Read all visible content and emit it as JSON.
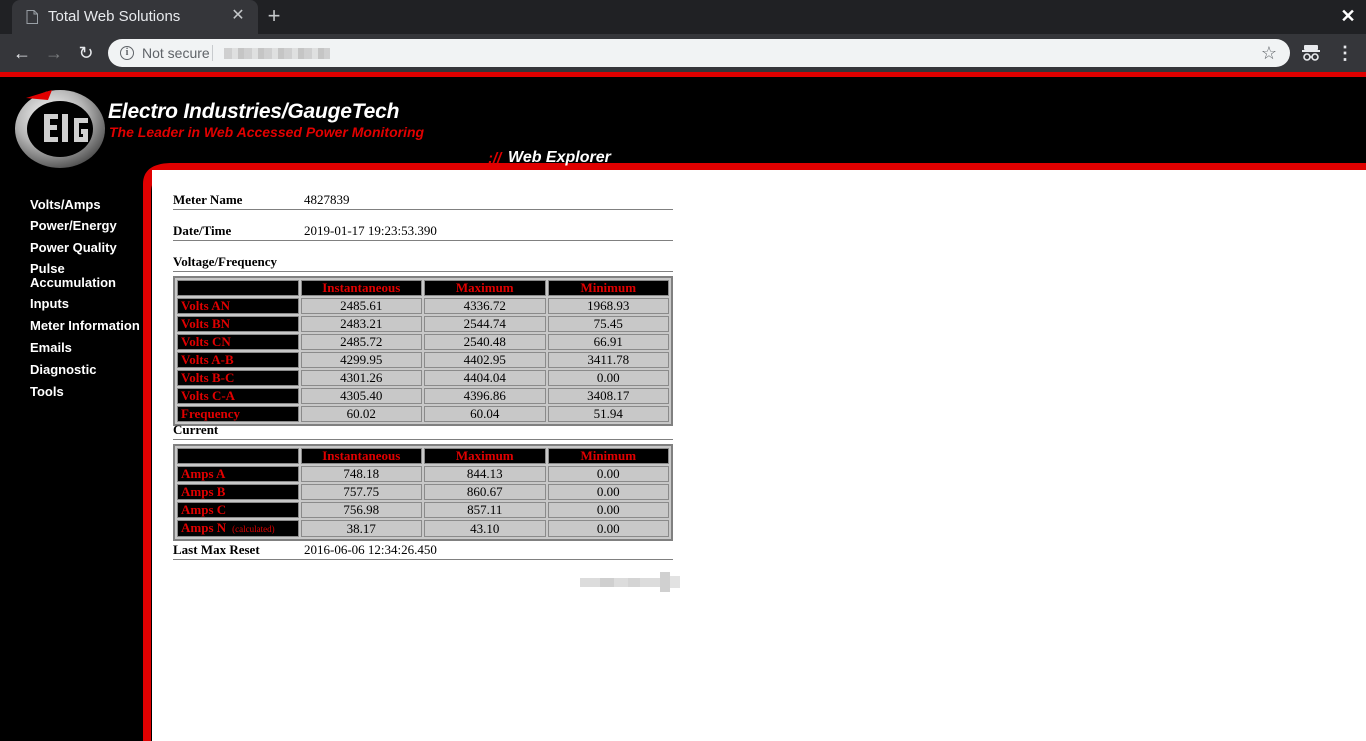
{
  "browser": {
    "tab_title": "Total Web Solutions",
    "close_glyph": "✕",
    "newtab_glyph": "+",
    "window_close_glyph": "✕",
    "not_secure": "Not secure",
    "back_glyph": "←",
    "forward_glyph": "→",
    "reload_glyph": "↻",
    "star_glyph": "☆",
    "menu_glyph": "⋮",
    "info_glyph": "i",
    "icons": [
      "page-icon",
      "close-icon",
      "plus-icon",
      "back-arrow-icon",
      "forward-arrow-icon",
      "reload-icon",
      "info-icon",
      "star-icon",
      "incognito-icon",
      "kebab-menu-icon"
    ]
  },
  "header": {
    "brand": "Electro Industries/GaugeTech",
    "tagline": "The Leader in Web Accessed Power Monitoring",
    "webexp_slashes": "://",
    "webexp": "Web Explorer",
    "colors": {
      "accent": "#e00000",
      "background": "#000000"
    }
  },
  "sidebar": {
    "items": [
      {
        "label": "Volts/Amps"
      },
      {
        "label": "Power/Energy"
      },
      {
        "label": "Power Quality"
      },
      {
        "label": "Pulse"
      },
      {
        "label": "Accumulation"
      },
      {
        "label": "Inputs"
      },
      {
        "label": "Meter Information"
      },
      {
        "label": "Emails"
      },
      {
        "label": "Diagnostic"
      },
      {
        "label": "Tools"
      }
    ]
  },
  "content": {
    "meter_name_label": "Meter Name",
    "meter_name_value": "4827839",
    "datetime_label": "Date/Time",
    "datetime_value": "2019-01-17 19:23:53.390",
    "vf_label": "Voltage/Frequency",
    "current_label": "Current",
    "last_reset_label": "Last Max Reset",
    "last_reset_value": "2016-06-06 12:34:26.450",
    "columns": {
      "inst": "Instantaneous",
      "max": "Maximum",
      "min": "Minimum"
    },
    "voltage_rows": [
      {
        "label": "Volts AN",
        "inst": "2485.61",
        "max": "4336.72",
        "min": "1968.93"
      },
      {
        "label": "Volts BN",
        "inst": "2483.21",
        "max": "2544.74",
        "min": "75.45"
      },
      {
        "label": "Volts CN",
        "inst": "2485.72",
        "max": "2540.48",
        "min": "66.91"
      },
      {
        "label": "Volts A-B",
        "inst": "4299.95",
        "max": "4402.95",
        "min": "3411.78"
      },
      {
        "label": "Volts B-C",
        "inst": "4301.26",
        "max": "4404.04",
        "min": "0.00"
      },
      {
        "label": "Volts C-A",
        "inst": "4305.40",
        "max": "4396.86",
        "min": "3408.17"
      },
      {
        "label": "Frequency",
        "inst": "60.02",
        "max": "60.04",
        "min": "51.94"
      }
    ],
    "current_rows": [
      {
        "label": "Amps A",
        "inst": "748.18",
        "max": "844.13",
        "min": "0.00"
      },
      {
        "label": "Amps B",
        "inst": "757.75",
        "max": "860.67",
        "min": "0.00"
      },
      {
        "label": "Amps C",
        "inst": "756.98",
        "max": "857.11",
        "min": "0.00"
      },
      {
        "label": "Amps N",
        "note": "(calculated)",
        "inst": "38.17",
        "max": "43.10",
        "min": "0.00"
      }
    ]
  }
}
